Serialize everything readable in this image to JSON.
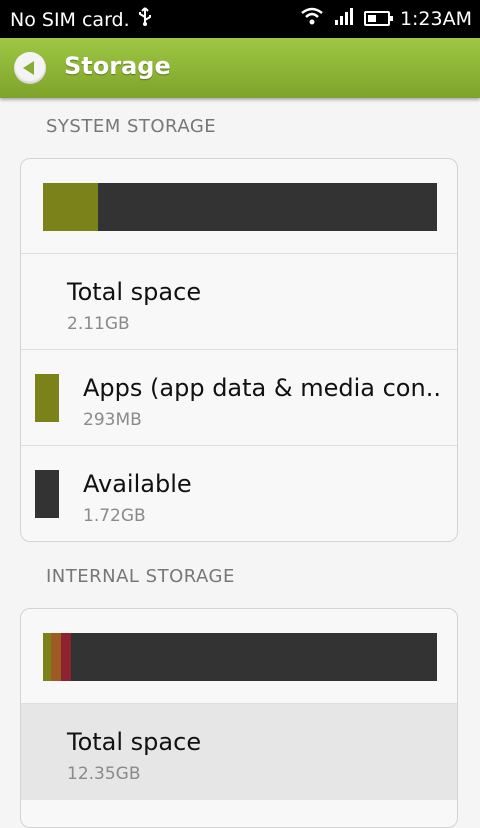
{
  "status_bar": {
    "carrier": "No SIM card.",
    "time": "1:23AM",
    "icons": [
      "usb-icon",
      "wifi-icon",
      "signal-icon",
      "battery-icon"
    ]
  },
  "header": {
    "title": "Storage",
    "back_icon": "back-arrow-icon"
  },
  "system_storage": {
    "title": "SYSTEM STORAGE",
    "segments": [
      {
        "color": "#7b8219",
        "fraction": 0.14
      }
    ],
    "rows": [
      {
        "label": "Total space",
        "value": "2.11GB"
      },
      {
        "label": "Apps (app data & media con..",
        "value": "293MB",
        "color": "#7b8219"
      },
      {
        "label": "Available",
        "value": "1.72GB",
        "color": "#333333"
      }
    ]
  },
  "internal_storage": {
    "title": "INTERNAL STORAGE",
    "segments": [
      {
        "color": "#7b8219",
        "fraction": 0.02
      },
      {
        "color": "#9e5a23",
        "fraction": 0.025
      },
      {
        "color": "#8e2330",
        "fraction": 0.025
      }
    ],
    "rows": [
      {
        "label": "Total space",
        "value": "12.35GB"
      }
    ]
  }
}
